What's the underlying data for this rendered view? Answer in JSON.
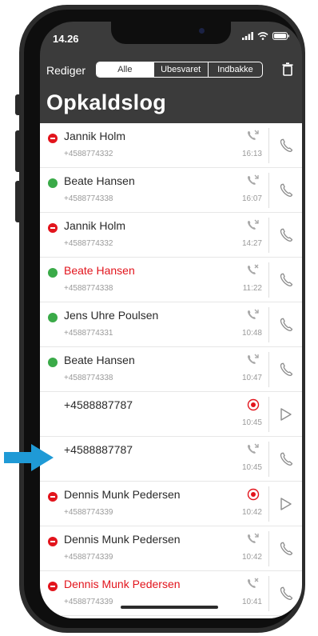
{
  "status": {
    "time": "14.26"
  },
  "header": {
    "edit_label": "Rediger",
    "tabs": [
      {
        "label": "Alle",
        "active": true
      },
      {
        "label": "Ubesvaret",
        "active": false
      },
      {
        "label": "Indbakke",
        "active": false
      }
    ],
    "title": "Opkaldslog"
  },
  "calls": [
    {
      "name": "Jannik Holm",
      "number": "+4588774332",
      "time": "16:13",
      "status": "red",
      "missed": false,
      "type": "call",
      "action": "call"
    },
    {
      "name": "Beate Hansen",
      "number": "+4588774338",
      "time": "16:07",
      "status": "green",
      "missed": false,
      "type": "call",
      "action": "call"
    },
    {
      "name": "Jannik Holm",
      "number": "+4588774332",
      "time": "14:27",
      "status": "red",
      "missed": false,
      "type": "call",
      "action": "call"
    },
    {
      "name": "Beate Hansen",
      "number": "+4588774338",
      "time": "11:22",
      "status": "green",
      "missed": true,
      "type": "missed",
      "action": "call"
    },
    {
      "name": "Jens Uhre Poulsen",
      "number": "+4588774331",
      "time": "10:48",
      "status": "green",
      "missed": false,
      "type": "call",
      "action": "call"
    },
    {
      "name": "Beate Hansen",
      "number": "+4588774338",
      "time": "10:47",
      "status": "green",
      "missed": false,
      "type": "call",
      "action": "call"
    },
    {
      "name": "+4588887787",
      "number": "",
      "time": "10:45",
      "status": "none",
      "missed": false,
      "type": "voicemail",
      "action": "play"
    },
    {
      "name": "+4588887787",
      "number": "",
      "time": "10:45",
      "status": "none",
      "missed": false,
      "type": "call",
      "action": "call"
    },
    {
      "name": "Dennis Munk Pedersen",
      "number": "+4588774339",
      "time": "10:42",
      "status": "red",
      "missed": false,
      "type": "voicemail",
      "action": "play"
    },
    {
      "name": "Dennis Munk Pedersen",
      "number": "+4588774339",
      "time": "10:42",
      "status": "red",
      "missed": false,
      "type": "call",
      "action": "call"
    },
    {
      "name": "Dennis Munk Pedersen",
      "number": "+4588774339",
      "time": "10:41",
      "status": "red",
      "missed": true,
      "type": "missed",
      "action": "call"
    }
  ],
  "colors": {
    "accent_red": "#e2141c",
    "presence_green": "#3aaa48",
    "header_bg": "#3b3b3b",
    "pointer_arrow": "#1f9ad6"
  },
  "icons": {
    "call_type": "phone-arrow-icon",
    "missed_type": "phone-x-icon",
    "voicemail_type": "record-icon",
    "call_action": "phone-icon",
    "play_action": "play-icon",
    "delete": "trash-icon",
    "pointer": "arrow-right-icon"
  }
}
